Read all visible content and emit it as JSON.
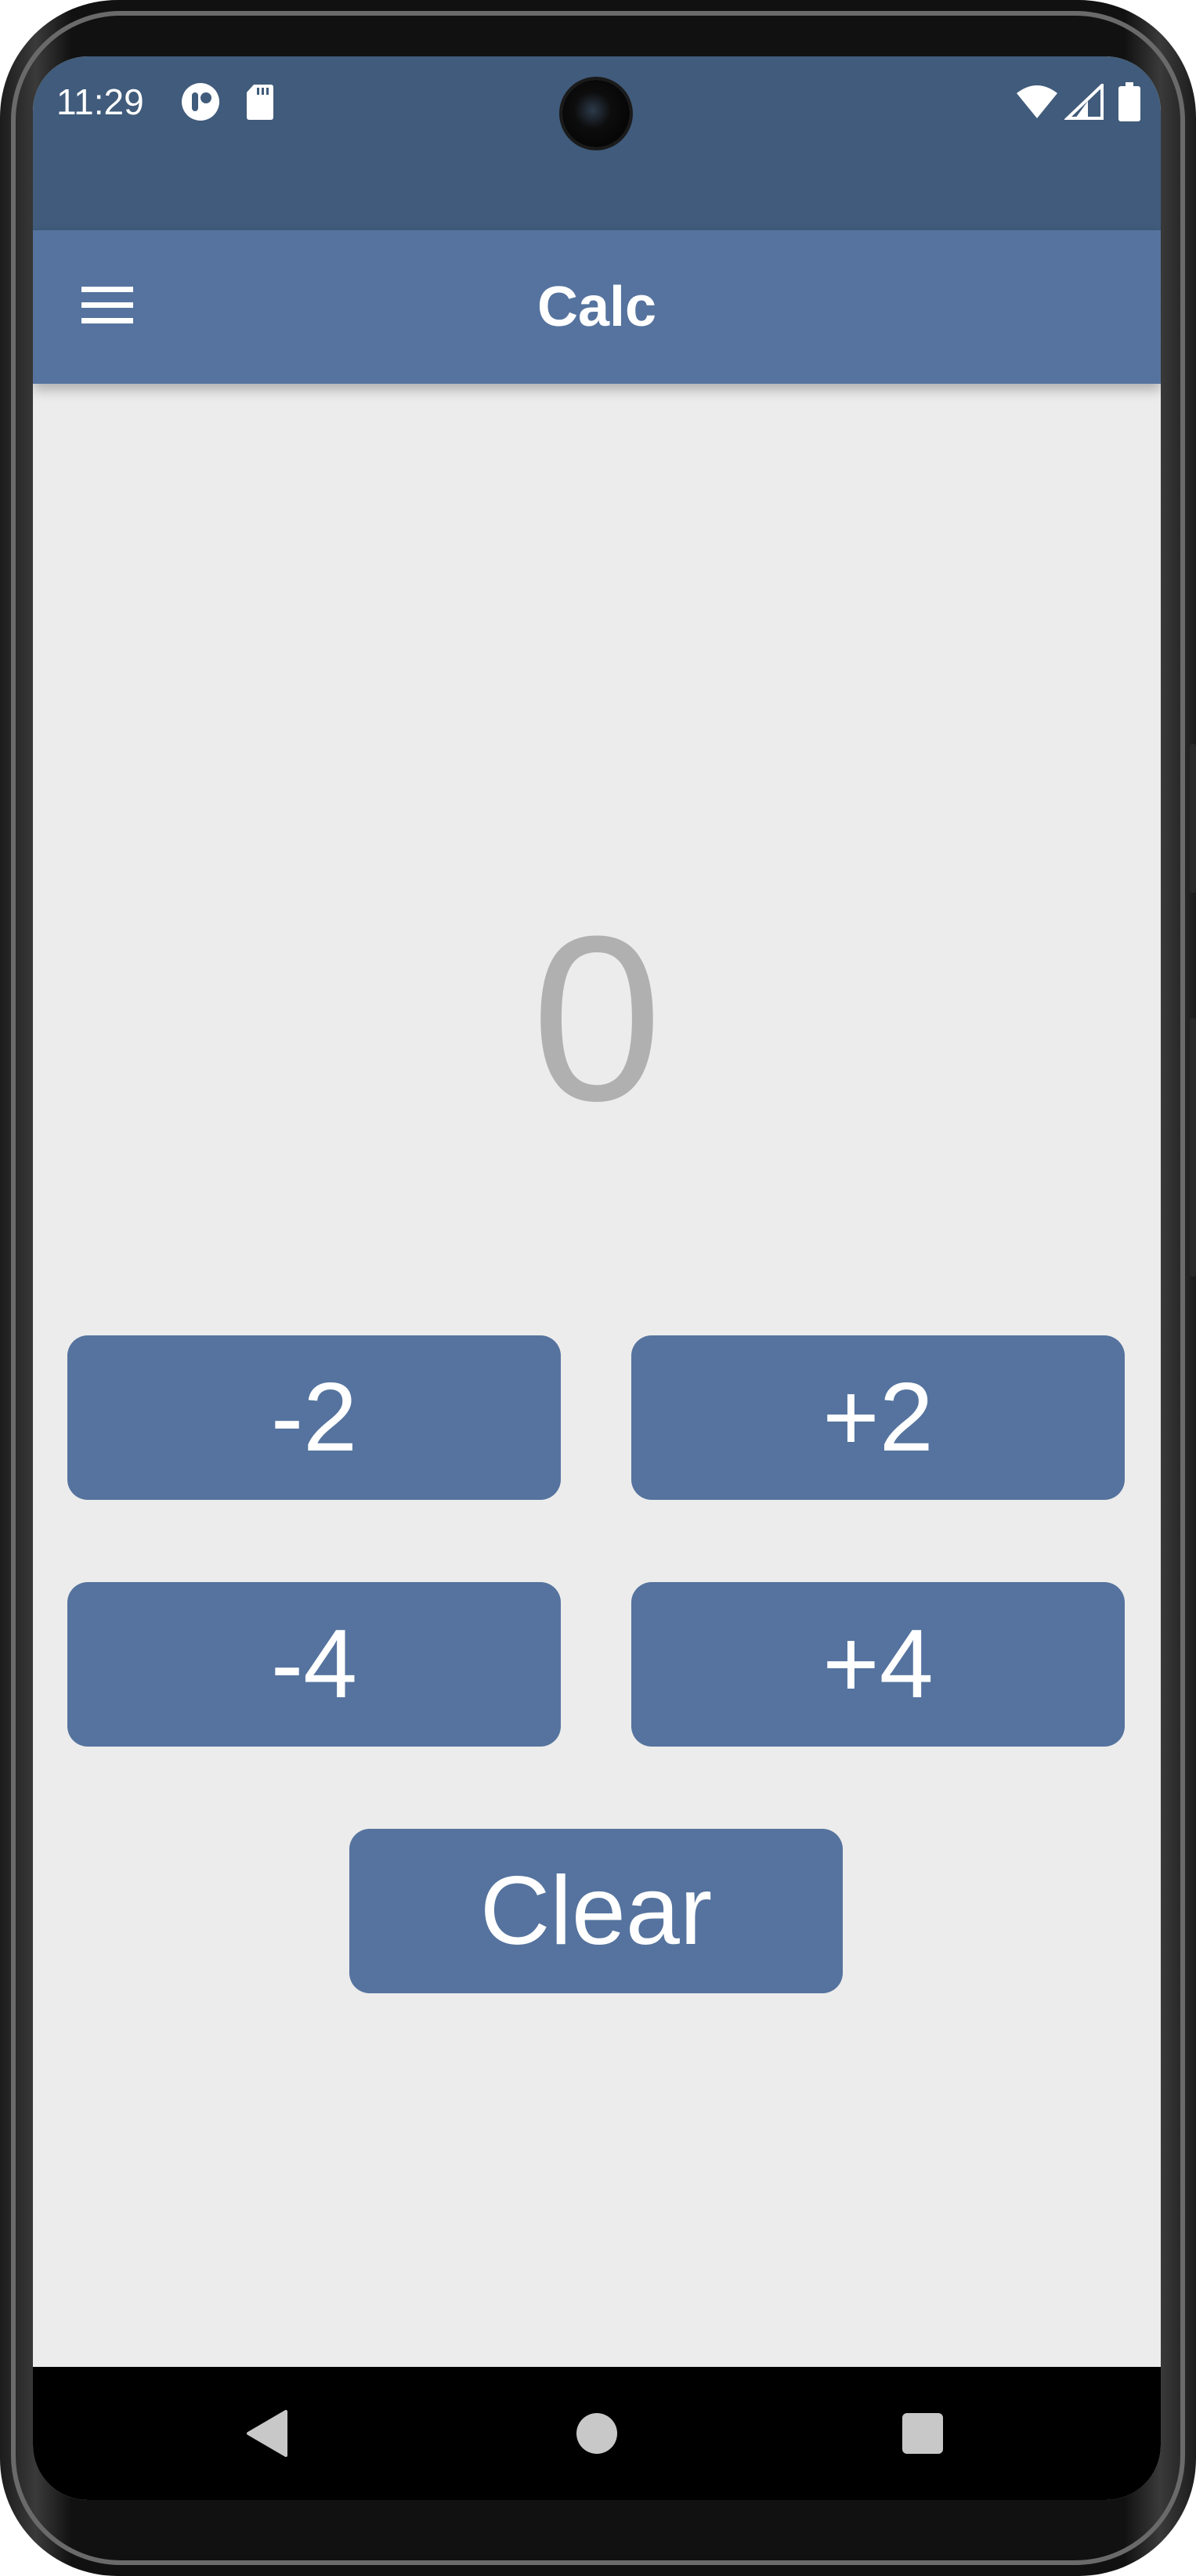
{
  "status_bar": {
    "time": "11:29",
    "left_icons": [
      "assistant-icon",
      "sd-card-icon"
    ],
    "right_icons": [
      "wifi-icon",
      "signal-icon",
      "battery-icon"
    ]
  },
  "app_bar": {
    "title": "Calc",
    "menu_icon": "hamburger-menu-icon"
  },
  "display": {
    "value": "0"
  },
  "buttons": {
    "minus_2": "-2",
    "plus_2": "+2",
    "minus_4": "-4",
    "plus_4": "+4",
    "clear": "Clear"
  },
  "nav_bar": {
    "icons": [
      "back-icon",
      "home-icon",
      "recents-icon"
    ]
  },
  "colors": {
    "status_bar": "#405b7b",
    "app_bar": "#55739e",
    "button": "#55739e",
    "background": "#ececec",
    "display_text": "#b0b0b0"
  }
}
